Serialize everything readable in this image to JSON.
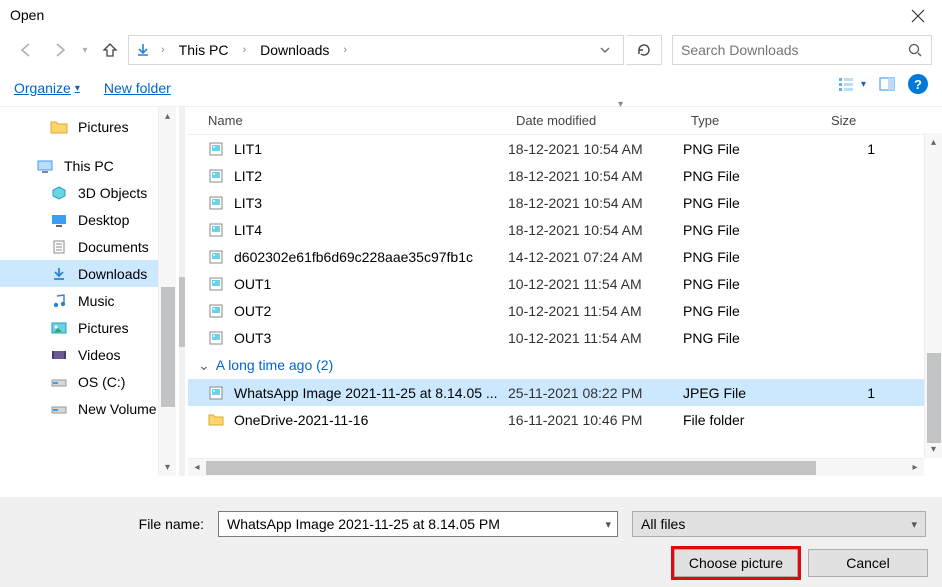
{
  "title": "Open",
  "breadcrumb": {
    "p1": "This PC",
    "p2": "Downloads"
  },
  "search": {
    "placeholder": "Search Downloads"
  },
  "toolbar": {
    "organize": "Organize",
    "new_folder": "New folder"
  },
  "sidebar": {
    "items": [
      {
        "label": "Pictures",
        "kind": "folder",
        "indent": true
      },
      {
        "label": "This PC",
        "kind": "pc",
        "indent": false
      },
      {
        "label": "3D Objects",
        "kind": "3d",
        "indent": true
      },
      {
        "label": "Desktop",
        "kind": "desktop",
        "indent": true
      },
      {
        "label": "Documents",
        "kind": "docs",
        "indent": true
      },
      {
        "label": "Downloads",
        "kind": "downloads",
        "indent": true,
        "selected": true
      },
      {
        "label": "Music",
        "kind": "music",
        "indent": true
      },
      {
        "label": "Pictures",
        "kind": "pictures",
        "indent": true
      },
      {
        "label": "Videos",
        "kind": "videos",
        "indent": true
      },
      {
        "label": "OS (C:)",
        "kind": "drive",
        "indent": true
      },
      {
        "label": "New Volume (D:)",
        "kind": "drive",
        "indent": true
      }
    ]
  },
  "columns": {
    "name": "Name",
    "date": "Date modified",
    "type": "Type",
    "size": "Size"
  },
  "files": [
    {
      "name": "LIT1",
      "date": "18-12-2021 10:54 AM",
      "type": "PNG File",
      "size": "1",
      "icon": "image"
    },
    {
      "name": "LIT2",
      "date": "18-12-2021 10:54 AM",
      "type": "PNG File",
      "size": "",
      "icon": "image"
    },
    {
      "name": "LIT3",
      "date": "18-12-2021 10:54 AM",
      "type": "PNG File",
      "size": "",
      "icon": "image"
    },
    {
      "name": "LIT4",
      "date": "18-12-2021 10:54 AM",
      "type": "PNG File",
      "size": "",
      "icon": "image"
    },
    {
      "name": "d602302e61fb6d69c228aae35c97fb1c",
      "date": "14-12-2021 07:24 AM",
      "type": "PNG File",
      "size": "",
      "icon": "image"
    },
    {
      "name": "OUT1",
      "date": "10-12-2021 11:54 AM",
      "type": "PNG File",
      "size": "",
      "icon": "image"
    },
    {
      "name": "OUT2",
      "date": "10-12-2021 11:54 AM",
      "type": "PNG File",
      "size": "",
      "icon": "image"
    },
    {
      "name": "OUT3",
      "date": "10-12-2021 11:54 AM",
      "type": "PNG File",
      "size": "",
      "icon": "image"
    }
  ],
  "group": {
    "label": "A long time ago (2)"
  },
  "files2": [
    {
      "name": "WhatsApp Image 2021-11-25 at 8.14.05 ...",
      "date": "25-11-2021 08:22 PM",
      "type": "JPEG File",
      "size": "1",
      "icon": "image",
      "selected": true
    },
    {
      "name": "OneDrive-2021-11-16",
      "date": "16-11-2021 10:46 PM",
      "type": "File folder",
      "size": "",
      "icon": "folder"
    }
  ],
  "bottom": {
    "label": "File name:",
    "value": "WhatsApp Image 2021-11-25 at 8.14.05 PM",
    "filter": "All files",
    "choose": "Choose picture",
    "cancel": "Cancel"
  }
}
